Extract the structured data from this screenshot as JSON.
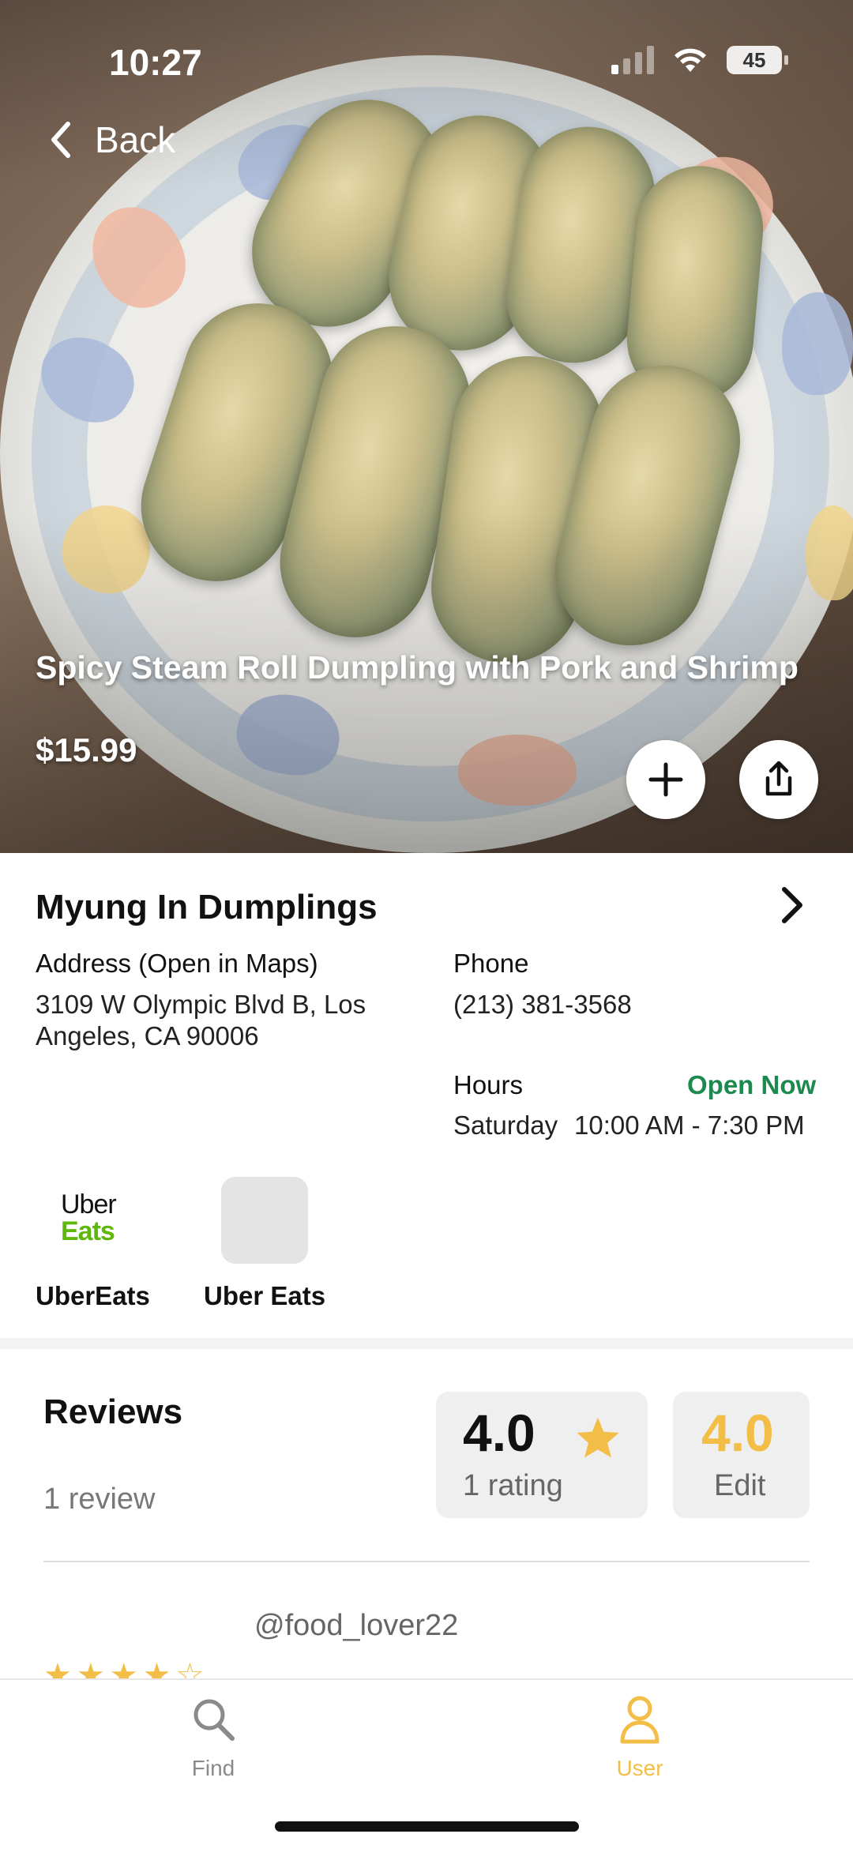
{
  "status_bar": {
    "time": "10:27",
    "battery": "45"
  },
  "nav": {
    "back_label": "Back"
  },
  "item": {
    "title": "Spicy Steam Roll Dumpling with Pork and Shrimp",
    "price": "$15.99"
  },
  "restaurant": {
    "name": "Myung In Dumplings",
    "address_label": "Address (Open in Maps)",
    "address_line1": "3109 W Olympic Blvd B, Los",
    "address_line2": "Angeles, CA 90006",
    "phone_label": "Phone",
    "phone": "(213) 381-3568",
    "hours_label": "Hours",
    "open_status": "Open Now",
    "hours_day": "Saturday",
    "hours_time": "10:00 AM - 7:30 PM"
  },
  "partners": [
    {
      "label": "UberEats",
      "logo_line1": "Uber",
      "logo_line2": "Eats"
    },
    {
      "label": "Uber Eats"
    }
  ],
  "reviews": {
    "title": "Reviews",
    "count": "1 review",
    "average": "4.0",
    "rating_count": "1 rating",
    "my_rating": "4.0",
    "edit_label": "Edit",
    "first_review": {
      "username": "@food_lover22",
      "stars": 4
    }
  },
  "tabs": [
    {
      "label": "Find",
      "icon": "search-icon",
      "active": false
    },
    {
      "label": "User",
      "icon": "user-icon",
      "active": true
    }
  ],
  "colors": {
    "accent": "#f3be47",
    "open_green": "#1c8a4e",
    "inactive_tab": "#8a8a8a"
  }
}
